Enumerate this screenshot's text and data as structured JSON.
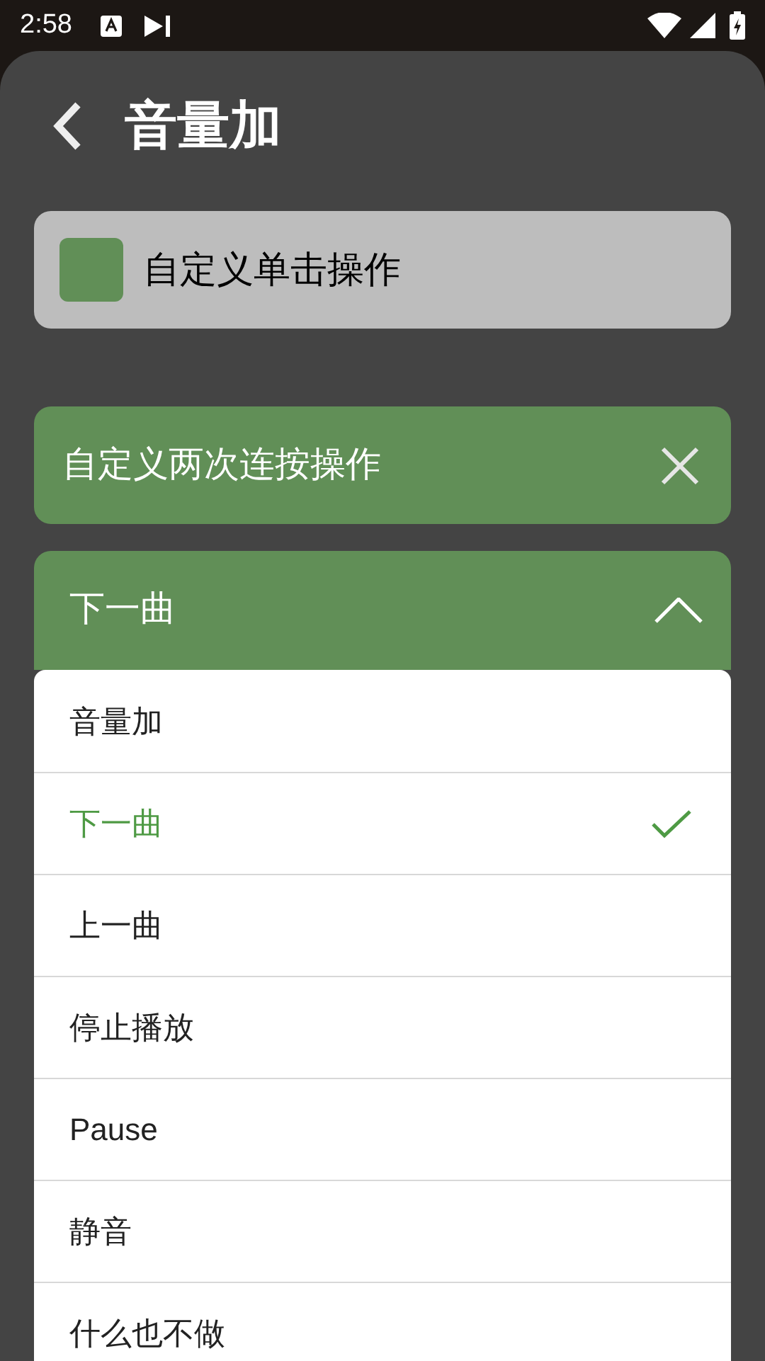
{
  "status_bar": {
    "time": "2:58"
  },
  "header": {
    "title": "音量加"
  },
  "single_click": {
    "label": "自定义单击操作"
  },
  "double_click": {
    "label": "自定义两次连按操作"
  },
  "dropdown": {
    "value": "下一曲",
    "expanded": true
  },
  "options": [
    {
      "label": "音量加",
      "selected": false
    },
    {
      "label": "下一曲",
      "selected": true
    },
    {
      "label": "上一曲",
      "selected": false
    },
    {
      "label": "停止播放",
      "selected": false
    },
    {
      "label": "Pause",
      "selected": false
    },
    {
      "label": "静音",
      "selected": false
    },
    {
      "label": "什么也不做",
      "selected": false
    }
  ]
}
